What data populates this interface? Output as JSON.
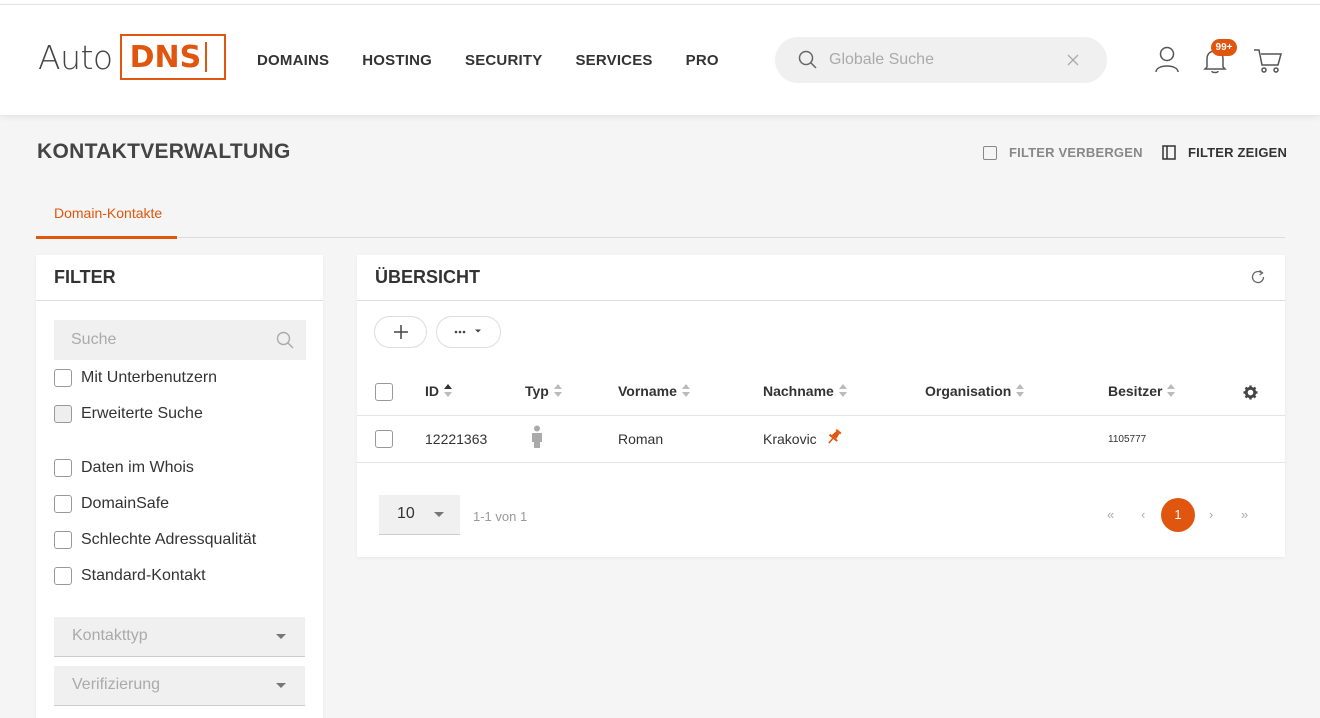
{
  "brand": {
    "auto": "Auto",
    "dns": "DNS",
    "accent": "#e0560f"
  },
  "nav": [
    "DOMAINS",
    "HOSTING",
    "SECURITY",
    "SERVICES",
    "PRO"
  ],
  "search": {
    "placeholder": "Globale Suche"
  },
  "notifications": {
    "badge": "99+"
  },
  "page": {
    "title": "KONTAKTVERWALTUNG",
    "filter_hide": "FILTER VERBERGEN",
    "filter_show": "FILTER ZEIGEN",
    "tab": "Domain-Kontakte"
  },
  "filter": {
    "title": "FILTER",
    "search_placeholder": "Suche",
    "checkboxes": [
      "Mit Unterbenutzern",
      "Erweiterte Suche",
      "Daten im Whois",
      "DomainSafe",
      "Schlechte Adressqualität",
      "Standard-Kontakt"
    ],
    "selects": [
      "Kontakttyp",
      "Verifizierung"
    ]
  },
  "overview": {
    "title": "ÜBERSICHT",
    "columns": [
      "ID",
      "Typ",
      "Vorname",
      "Nachname",
      "Organisation",
      "Besitzer"
    ],
    "rows": [
      {
        "id": "12221363",
        "typ": "person-icon",
        "vorname": "Roman",
        "nachname": "Krakovic",
        "organisation": "",
        "besitzer": "1105777"
      }
    ],
    "per_page": "10",
    "range": "1-1 von 1",
    "pagination": {
      "first": "«",
      "prev": "‹",
      "current": "1",
      "next": "›",
      "last": "»"
    }
  }
}
